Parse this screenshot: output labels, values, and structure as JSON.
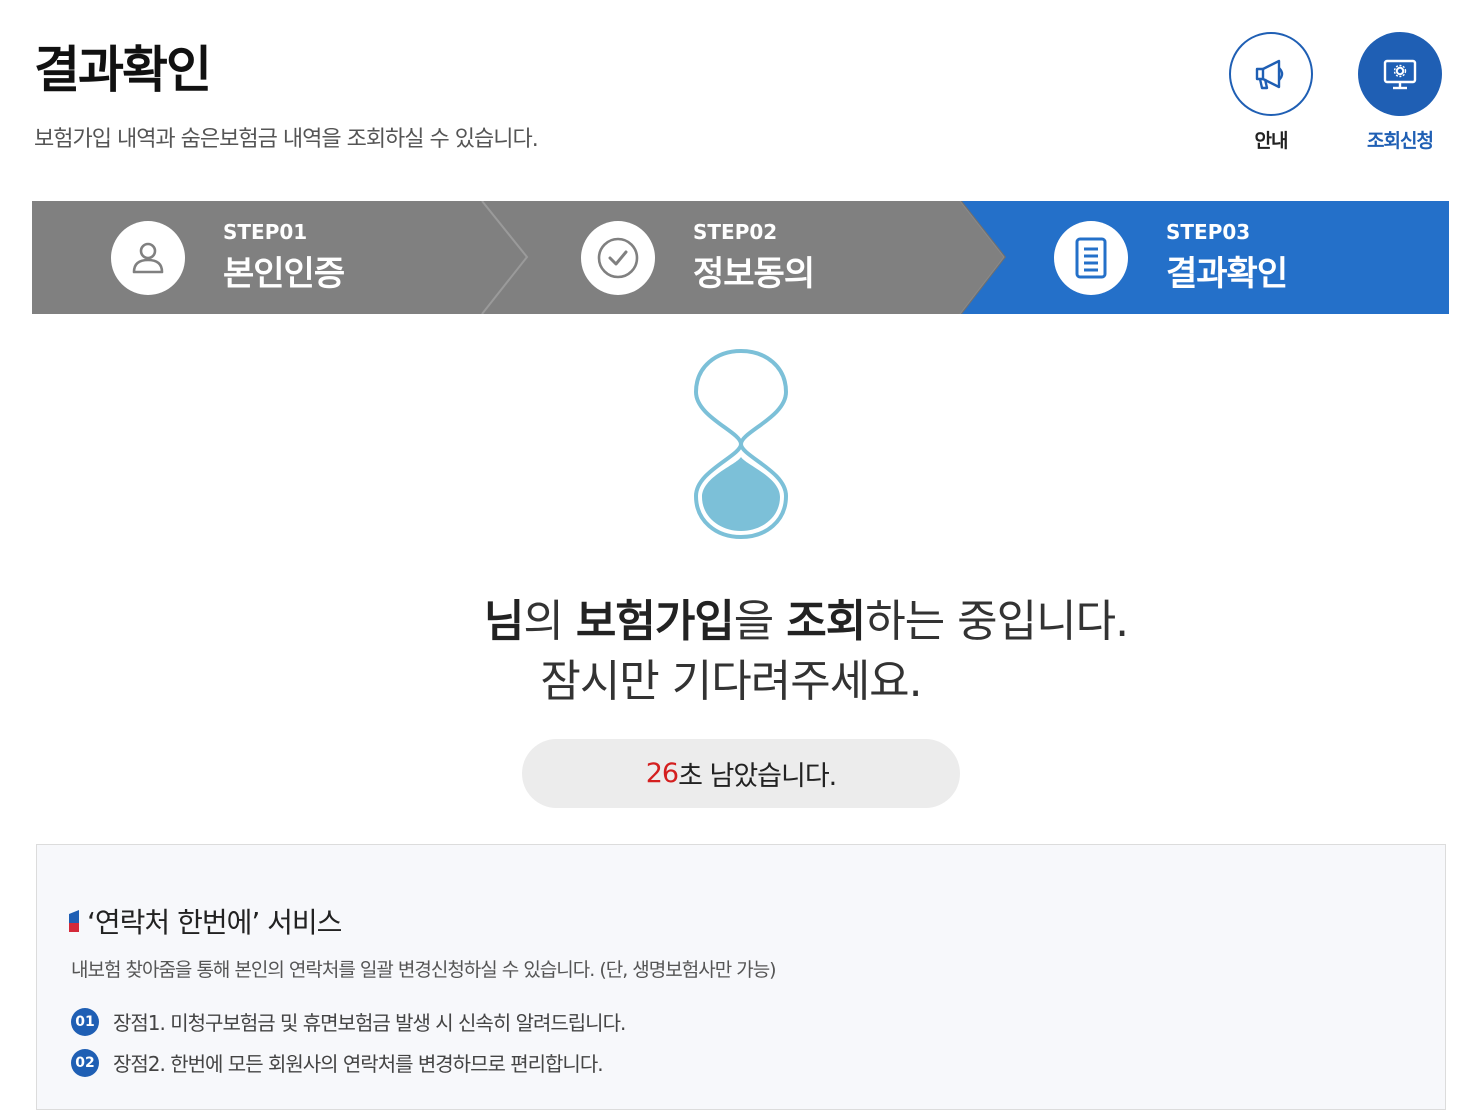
{
  "header": {
    "title": "결과확인",
    "subtitle": "보험가입 내역과 숨은보험금 내역을 조회하실 수 있습니다."
  },
  "top_buttons": {
    "guide_label": "안내",
    "guide_icon": "megaphone-icon",
    "apply_label": "조회신청",
    "apply_icon": "monitor-icon"
  },
  "steps": [
    {
      "num": "STEP01",
      "name": "본인인증",
      "icon": "person-icon",
      "active": false
    },
    {
      "num": "STEP02",
      "name": "정보동의",
      "icon": "check-circle-icon",
      "active": false
    },
    {
      "num": "STEP03",
      "name": "결과확인",
      "icon": "document-icon",
      "active": true
    }
  ],
  "status": {
    "line1_name_suffix": "님",
    "line1_part1": "의 ",
    "line1_bold1": "보험가입",
    "line1_part2": "을 ",
    "line1_bold2": "조회",
    "line1_part3": "하는 중입니다.",
    "line2": "잠시만 기다려주세요.",
    "countdown_seconds": "26",
    "countdown_suffix": "초 남았습니다."
  },
  "info": {
    "title": "‘연락처 한번에’ 서비스",
    "description": "내보험 찾아줌을 통해 본인의 연락처를 일괄 변경신청하실 수 있습니다. (단, 생명보험사만 가능)",
    "benefits": [
      {
        "badge": "01",
        "text": "장점1. 미청구보험금 및 휴면보험금 발생 시 신속히 알려드립니다."
      },
      {
        "badge": "02",
        "text": "장점2. 한번에 모든 회원사의 연락처를 변경하므로 편리합니다."
      }
    ]
  },
  "colors": {
    "primary_blue": "#1f5fb4",
    "step_gray": "#808080",
    "step_active": "#2470c9",
    "countdown_red": "#d41f1f",
    "hourglass": "#7cc0d8"
  }
}
